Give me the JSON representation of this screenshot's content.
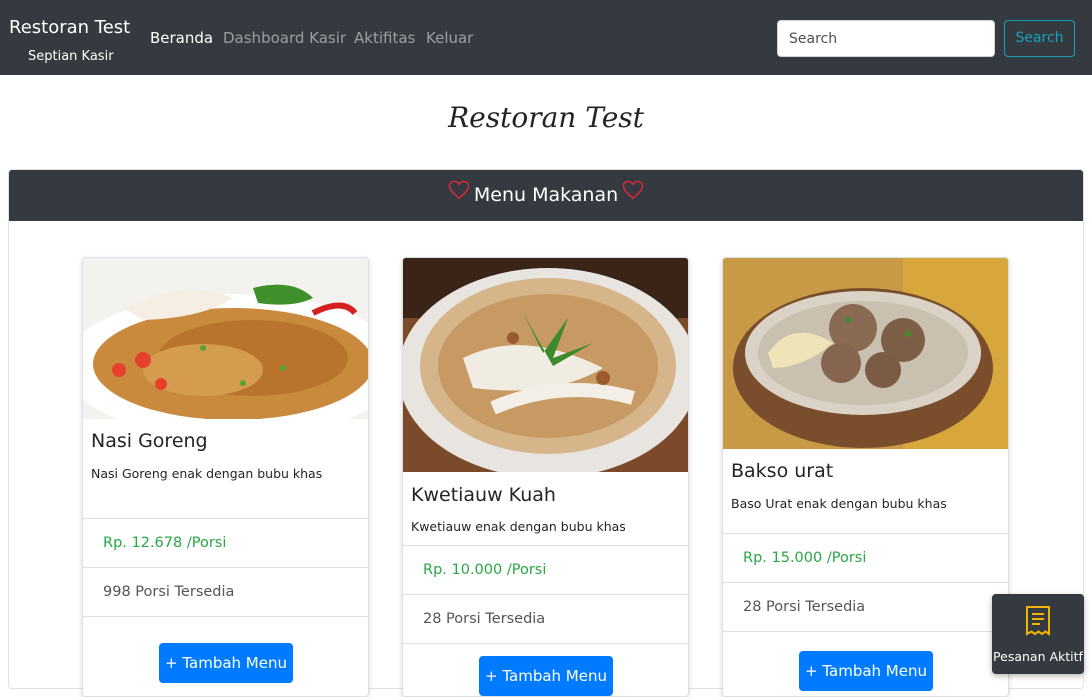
{
  "navbar": {
    "brand": "Restoran Test",
    "brand_sub": "Septian Kasir",
    "links": [
      {
        "label": "Beranda",
        "active": true
      },
      {
        "label": "Dashboard Kasir",
        "active": false
      },
      {
        "label": "Aktifitas",
        "active": false
      },
      {
        "label": "Keluar",
        "active": false
      }
    ],
    "search_placeholder": "Search",
    "search_button": "Search"
  },
  "page_title": "Restoran Test",
  "section": {
    "title": "Menu Makanan",
    "heart_color": "#e0283a"
  },
  "menu_items": [
    {
      "name": "Nasi Goreng",
      "description": "Nasi Goreng enak dengan bubu khas",
      "price": "Rp. 12.678 /Porsi",
      "stock": "998 Porsi Tersedia",
      "button": "+ Tambah Menu"
    },
    {
      "name": "Kwetiauw Kuah",
      "description": "Kwetiauw enak dengan bubu khas",
      "price": "Rp. 10.000 /Porsi",
      "stock": "28 Porsi Tersedia",
      "button": "+ Tambah Menu"
    },
    {
      "name": "Bakso urat",
      "description": "Baso Urat enak dengan bubu khas",
      "price": "Rp. 15.000 /Porsi",
      "stock": "28 Porsi Tersedia",
      "button": "+ Tambah Menu"
    }
  ],
  "floating": {
    "label": "Pesanan Aktitf",
    "icon": "receipt-icon",
    "icon_color": "#f0b400"
  },
  "colors": {
    "navbar_bg": "#343a40",
    "price": "#28a745",
    "primary_button": "#007bff",
    "search_outline": "#17a2b8"
  }
}
